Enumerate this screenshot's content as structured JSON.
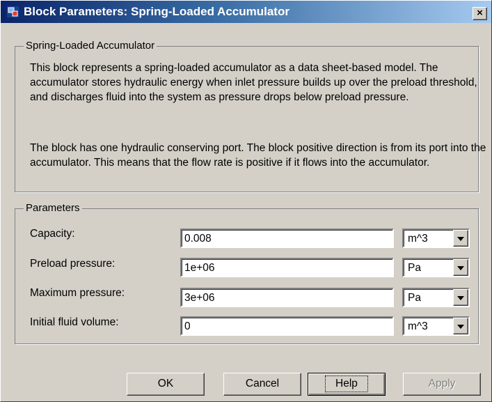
{
  "window": {
    "title": "Block Parameters: Spring-Loaded Accumulator",
    "close_label": "×"
  },
  "description_group": {
    "legend": "Spring-Loaded Accumulator",
    "paragraph1": "This block represents a spring-loaded accumulator as a data sheet-based model. The accumulator stores hydraulic energy when inlet pressure builds up over the preload threshold, and discharges fluid into the system as pressure drops below preload pressure.",
    "paragraph2": "The block has one hydraulic conserving port. The block positive direction is from its port into the accumulator. This means that the flow rate is positive if it flows into the accumulator."
  },
  "parameters_group": {
    "legend": "Parameters",
    "rows": [
      {
        "label": "Capacity:",
        "value": "0.008",
        "unit": "m^3"
      },
      {
        "label": "Preload pressure:",
        "value": "1e+06",
        "unit": "Pa"
      },
      {
        "label": "Maximum pressure:",
        "value": "3e+06",
        "unit": "Pa"
      },
      {
        "label": "Initial fluid volume:",
        "value": "0",
        "unit": "m^3"
      }
    ]
  },
  "buttons": {
    "ok": "OK",
    "cancel": "Cancel",
    "help": "Help",
    "apply": "Apply"
  }
}
